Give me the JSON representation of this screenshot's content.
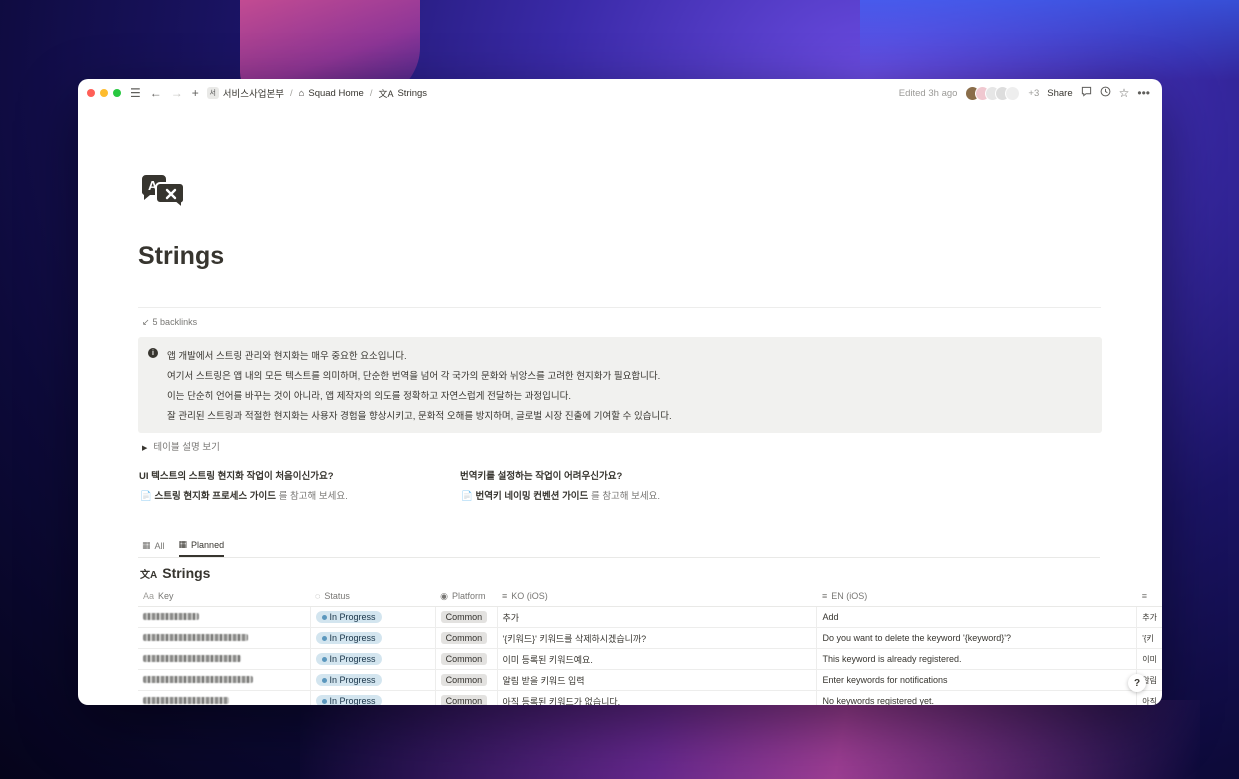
{
  "window": {
    "breadcrumbs": [
      {
        "icon": "workspace-badge",
        "badge": "서",
        "label": "서비스사업본부"
      },
      {
        "icon": "house-icon",
        "label": "Squad Home"
      },
      {
        "icon": "translate-icon",
        "label": "Strings"
      }
    ],
    "edited": "Edited 3h ago",
    "extra_viewers": "+3",
    "share_label": "Share"
  },
  "page": {
    "title": "Strings",
    "backlinks": "5 backlinks",
    "callout": [
      "앱 개발에서 스트링 관리와 현지화는 매우 중요한 요소입니다.",
      "여기서 스트링은 앱 내의 모든 텍스트를 의미하며, 단순한 번역을 넘어 각 국가의 문화와 뉘앙스를 고려한 현지화가 필요합니다.",
      "이는 단순히 언어를 바꾸는 것이 아니라, 앱 제작자의 의도를 정확하고 자연스럽게 전달하는 과정입니다.",
      "잘 관리된 스트링과 적절한 현지화는 사용자 경험을 향상시키고, 문화적 오해를 방지하며, 글로벌 시장 진출에 기여할 수 있습니다."
    ],
    "toggle_label": "테이블 설명 보기",
    "questions": [
      {
        "q": "UI 텍스트의 스트링 현지화 작업이 처음이신가요?",
        "link": "스트링 현지화 프로세스 가이드",
        "rest": "를 참고해 보세요."
      },
      {
        "q": "번역키를 설정하는 작업이 어려우신가요?",
        "link": "번역키 네이밍 컨벤션 가이드",
        "rest": "를 참고해 보세요."
      }
    ]
  },
  "tabs": [
    {
      "label": "All",
      "active": false
    },
    {
      "label": "Planned",
      "active": true
    }
  ],
  "database": {
    "title": "Strings",
    "columns": [
      {
        "prefix": "Aa",
        "label": "Key"
      },
      {
        "prefix": "",
        "label": "Status"
      },
      {
        "prefix": "",
        "label": "Platform"
      },
      {
        "prefix": "",
        "label": "KO (iOS)"
      },
      {
        "prefix": "",
        "label": "EN (iOS)"
      },
      {
        "prefix": "",
        "label": ""
      }
    ],
    "rows": [
      {
        "status": "In Progress",
        "platform": "Common",
        "ko": "추가",
        "en": "Add",
        "extra": "추가"
      },
      {
        "status": "In Progress",
        "platform": "Common",
        "ko": "'{키워드}' 키워드를 삭제하시겠습니까?",
        "en": "Do you want to delete the keyword '{keyword}'?",
        "extra": "'{키"
      },
      {
        "status": "In Progress",
        "platform": "Common",
        "ko": "이미 등록된 키워드예요.",
        "en": "This keyword is already registered.",
        "extra": "이미"
      },
      {
        "status": "In Progress",
        "platform": "Common",
        "ko": "알림 받을 키워드 입력",
        "en": "Enter keywords for notifications",
        "extra": "알림"
      },
      {
        "status": "In Progress",
        "platform": "Common",
        "ko": "아직 등록된 키워드가 없습니다.",
        "en": "No keywords registered yet.",
        "extra": "아직"
      }
    ]
  },
  "help_label": "?"
}
